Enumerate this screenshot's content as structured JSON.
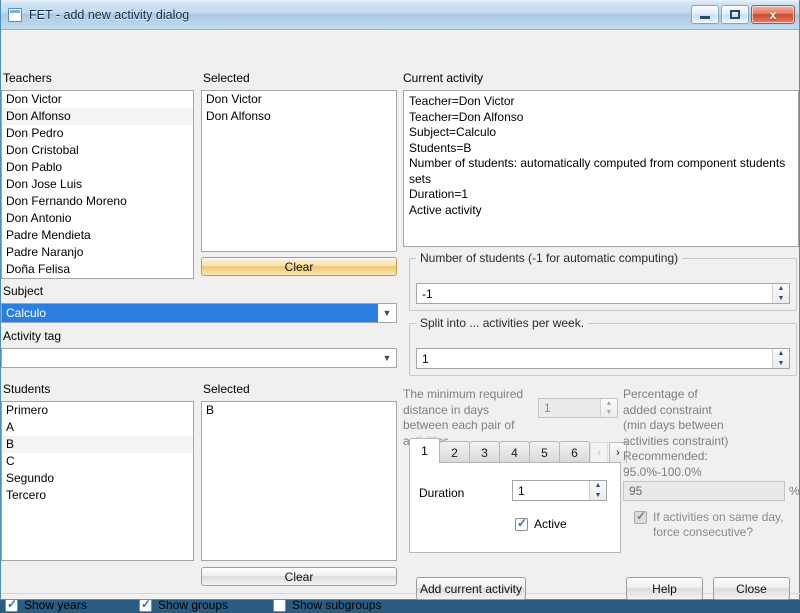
{
  "window": {
    "title": "FET - add new activity dialog",
    "app_icon": "app-window-icon",
    "minimize_label": "Minimize",
    "maximize_label": "Maximize",
    "close_label": "x"
  },
  "teachers": {
    "label": "Teachers",
    "items": [
      "Don Victor",
      "Don Alfonso",
      "Don Pedro",
      "Don Cristobal",
      "Don Pablo",
      "Don Jose Luis",
      "Don Fernando Moreno",
      "Don Antonio",
      "Padre Mendieta",
      "Padre Naranjo",
      "Doña Felisa"
    ],
    "selected_label": "Selected",
    "selected_items": [
      "Don Victor",
      "Don Alfonso"
    ],
    "clear_label": "Clear"
  },
  "subject": {
    "label": "Subject",
    "value": "Calculo"
  },
  "activity_tag": {
    "label": "Activity tag",
    "value": ""
  },
  "students": {
    "label": "Students",
    "items": [
      "Primero",
      "A",
      "B",
      "C",
      "Segundo",
      "Tercero"
    ],
    "selected_label": "Selected",
    "selected_items": [
      "B"
    ],
    "clear_label": "Clear"
  },
  "footer_checkboxes": [
    {
      "label": "Show years",
      "checked": true
    },
    {
      "label": "Show groups",
      "checked": true
    },
    {
      "label": "Show subgroups",
      "checked": false
    }
  ],
  "current_activity": {
    "label": "Current activity",
    "lines": [
      "Teacher=Don Victor",
      "Teacher=Don Alfonso",
      "Subject=Calculo",
      "Students=B",
      "Number of students: automatically computed from component students sets",
      "Duration=1",
      "Active activity"
    ]
  },
  "number_of_students": {
    "title": "Number of students (-1 for automatic computing)",
    "value": "-1"
  },
  "split_into": {
    "title": "Split into ... activities per week.",
    "value": "1"
  },
  "min_days": {
    "description": "The minimum required distance in days between each pair of activities",
    "value": "1"
  },
  "tabs": {
    "items": [
      "1",
      "2",
      "3",
      "4",
      "5",
      "6"
    ],
    "active_index": 0,
    "scroll_left": "‹",
    "scroll_right": "›"
  },
  "duration": {
    "label": "Duration",
    "value": "1",
    "active_label": "Active",
    "active_checked": true
  },
  "percentage": {
    "description_lines": [
      "Percentage of",
      "added constraint",
      " (min days between",
      "activities constraint)",
      "Recommended:",
      "95.0%-100.0%"
    ],
    "value": "95",
    "unit": "%",
    "force_consecutive_label_lines": [
      "If activities on",
      "same day, force",
      "consecutive?"
    ],
    "force_consecutive_checked": true
  },
  "actions": {
    "add_label": "Add current activity",
    "help_label": "Help",
    "close_label": "Close"
  },
  "colors": {
    "accent_blue": "#2a7fe0",
    "hot_button": "#f0c870",
    "close_red": "#c84a2e"
  }
}
